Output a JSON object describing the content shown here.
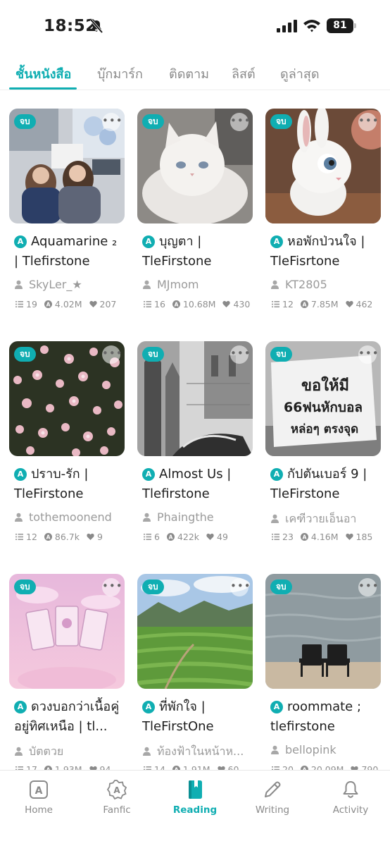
{
  "status_bar": {
    "time": "18:52",
    "battery": "81"
  },
  "tabs": [
    {
      "label": "ชั้นหนังสือ",
      "active": true
    },
    {
      "label": "บุ๊กมาร์ก",
      "active": false
    },
    {
      "label": "ติดตาม",
      "active": false
    },
    {
      "label": "ลิสต์",
      "active": false
    },
    {
      "label": "ดูล่าสุด",
      "active": false
    }
  ],
  "cards": [
    {
      "badge": "จบ",
      "title": "Aquamarine ₂ | Tlefirstone",
      "author": "SkyLer_★",
      "chapters": "19",
      "views": "4.02M",
      "likes": "207"
    },
    {
      "badge": "จบ",
      "title": "บุญตา | TleFirstone",
      "author": "MJmom",
      "chapters": "16",
      "views": "10.68M",
      "likes": "430"
    },
    {
      "badge": "จบ",
      "title": "หอพักป่วนใจ | TleFisrtone",
      "author": "KT2805",
      "chapters": "12",
      "views": "7.85M",
      "likes": "462"
    },
    {
      "badge": "จบ",
      "title": "ปราบ-รัก | TleFirstone",
      "author": "tothemoonend",
      "chapters": "12",
      "views": "86.7k",
      "likes": "9"
    },
    {
      "badge": "จบ",
      "title": "Almost Us | Tlefirstone",
      "author": "Phaingthe",
      "chapters": "6",
      "views": "422k",
      "likes": "49"
    },
    {
      "badge": "จบ",
      "title": "กัปตันเบอร์ 9 | TleFirstone",
      "author": "เคฑีวายเอ็นอา",
      "chapters": "23",
      "views": "4.16M",
      "likes": "185"
    },
    {
      "badge": "จบ",
      "title": "ดวงบอกว่าเนื้อคู่อยู่ทิศเหนือ | tl...",
      "author": "บัตตวย",
      "chapters": "17",
      "views": "1.93M",
      "likes": "94"
    },
    {
      "badge": "จบ",
      "title": "ที่พักใจ | TleFirstOne",
      "author": "ท้องฟ้าในหน้าห...",
      "chapters": "14",
      "views": "1.91M",
      "likes": "60"
    },
    {
      "badge": "จบ",
      "title": "roommate ; tlefirstone",
      "author": "bellopink",
      "chapters": "20",
      "views": "20.09M",
      "likes": "790"
    }
  ],
  "cover_text": {
    "card6_line1": "ขอให้มี",
    "card6_line2": "66ฟนหักบอล",
    "card6_line3": "หล่อๆ ตรงจุด"
  },
  "bottom_nav": [
    {
      "label": "Home",
      "icon": "home-a-icon",
      "active": false
    },
    {
      "label": "Fanfic",
      "icon": "fanfic-badge-icon",
      "active": false
    },
    {
      "label": "Reading",
      "icon": "reading-book-icon",
      "active": true
    },
    {
      "label": "Writing",
      "icon": "pencil-icon",
      "active": false
    },
    {
      "label": "Activity",
      "icon": "bell-icon",
      "active": false
    }
  ],
  "colors": {
    "accent": "#10aeb2",
    "muted_text": "#9a9a9a"
  }
}
